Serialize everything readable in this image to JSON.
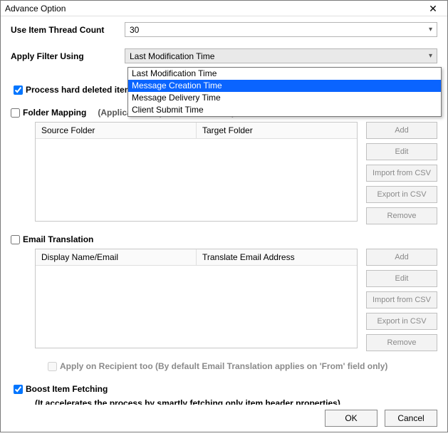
{
  "window": {
    "title": "Advance Option"
  },
  "threadCount": {
    "label": "Use Item Thread Count",
    "value": "30"
  },
  "filter": {
    "label": "Apply Filter Using",
    "selected": "Last Modification Time",
    "options": [
      "Last Modification Time",
      "Message Creation Time",
      "Message Delivery Time",
      "Client Submit Time"
    ],
    "highlighted_index": 1
  },
  "processHardDeleted": {
    "checked": true,
    "label": "Process hard deleted items"
  },
  "folderMapping": {
    "checked": false,
    "label": "Folder Mapping",
    "hint": "(Applicable only on Root Folders)",
    "columns": [
      "Source Folder",
      "Target Folder"
    ],
    "buttons": [
      "Add",
      "Edit",
      "Import from CSV",
      "Export in CSV",
      "Remove"
    ]
  },
  "emailTranslation": {
    "checked": false,
    "label": "Email Translation",
    "columns": [
      "Display Name/Email",
      "Translate Email Address"
    ],
    "buttons": [
      "Add",
      "Edit",
      "Import from CSV",
      "Export in CSV",
      "Remove"
    ],
    "recipientOption": {
      "checked": false,
      "label": "Apply on Recipient too (By default Email Translation applies on 'From' field only)"
    }
  },
  "boost": {
    "checked": true,
    "label": "Boost Item Fetching",
    "hint": "(It accelerates the process by smartly fetching only item header properties)"
  },
  "footer": {
    "ok": "OK",
    "cancel": "Cancel"
  }
}
